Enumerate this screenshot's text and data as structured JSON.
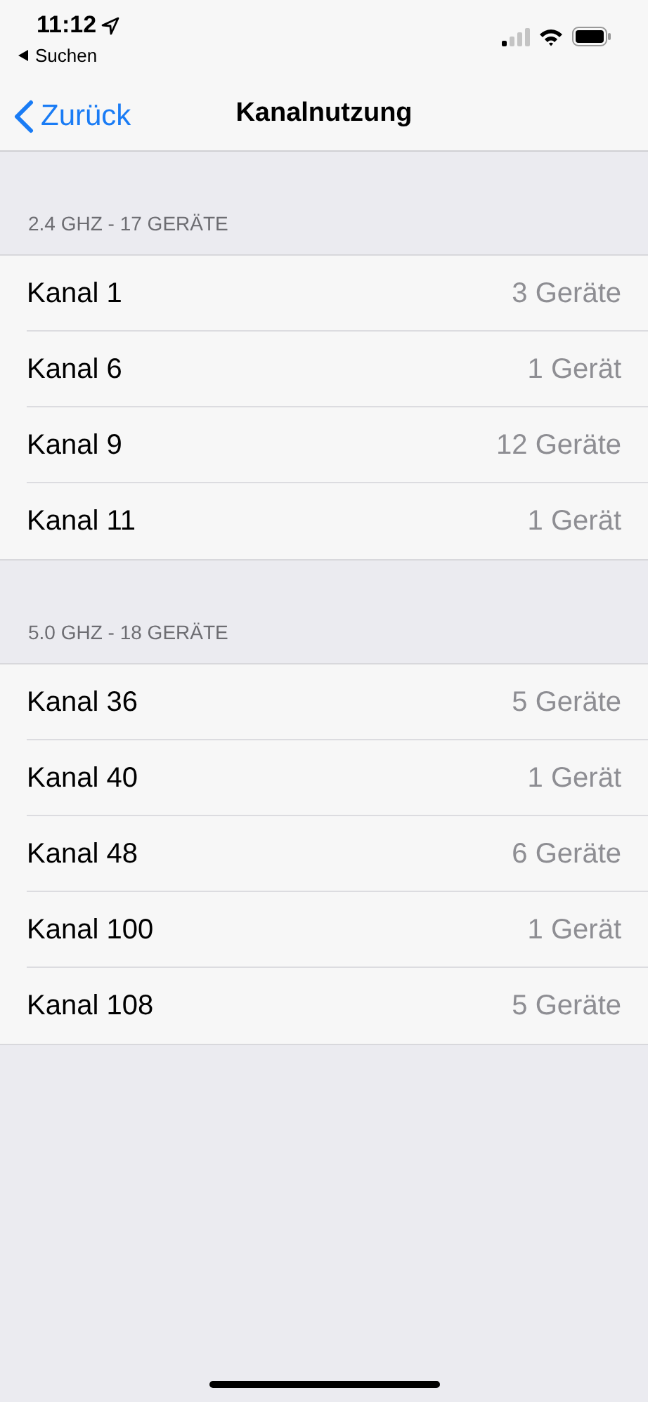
{
  "status_bar": {
    "time": "11:12",
    "back_app": "Suchen"
  },
  "nav": {
    "back": "Zurück",
    "title": "Kanalnutzung"
  },
  "sections": [
    {
      "header": "2.4 GHZ - 17 GERÄTE",
      "rows": [
        {
          "label": "Kanal 1",
          "value": "3 Geräte"
        },
        {
          "label": "Kanal 6",
          "value": "1 Gerät"
        },
        {
          "label": "Kanal 9",
          "value": "12 Geräte"
        },
        {
          "label": "Kanal 11",
          "value": "1 Gerät"
        }
      ]
    },
    {
      "header": "5.0 GHZ - 18 GERÄTE",
      "rows": [
        {
          "label": "Kanal 36",
          "value": "5 Geräte"
        },
        {
          "label": "Kanal 40",
          "value": "1 Gerät"
        },
        {
          "label": "Kanal 48",
          "value": "6 Geräte"
        },
        {
          "label": "Kanal 100",
          "value": "1 Gerät"
        },
        {
          "label": "Kanal 108",
          "value": "5 Geräte"
        }
      ]
    }
  ]
}
